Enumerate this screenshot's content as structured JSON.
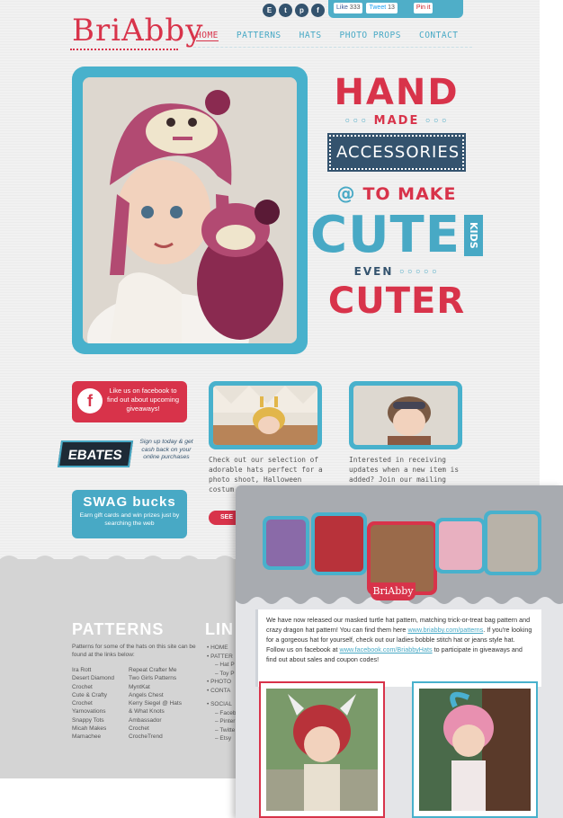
{
  "site": {
    "logo": "BriAbby",
    "social_icons": [
      "E",
      "t",
      "p",
      "f"
    ],
    "share": {
      "like": "Like",
      "like_count": "333",
      "tweet": "Tweet",
      "tweet_count": "13",
      "pin": "Pin it"
    },
    "nav": [
      "HOME",
      "PATTERNS",
      "HATS",
      "PHOTO PROPS",
      "CONTACT"
    ],
    "tagline": {
      "hand": "HAND",
      "made": "MADE",
      "accessories": "ACCESSORIES",
      "to_make": "TO MAKE",
      "cute": "CUTE",
      "kids": "KIDS",
      "even": "EVEN",
      "cuter": "CUTER"
    },
    "facebook_box": {
      "icon": "f",
      "text": "Like us on facebook to find out about upcoming giveaways!"
    },
    "ebates": {
      "badge": "EBATES",
      "text": "Sign up today & get cash back on your online purchases"
    },
    "swagbucks": {
      "logo": "SWAG bucks",
      "text": "Earn gift cards and win prizes just by searching the web"
    },
    "thumb_text_1": "Check out our selection of adorable hats perfect for a photo shoot, Halloween costum... dress-",
    "thumb_text_2": "Interested in receiving updates when a new item is added? Join our mailing list",
    "see_button": "SEE"
  },
  "footer": {
    "patterns_title": "PATTERNS",
    "patterns_desc": "Patterns for some of the hats on this site can be found at the links below:",
    "patterns_col1": [
      "Ira Rott",
      "Desert Diamond",
      "Crochet",
      "Cute & Crafty",
      "Crochet",
      "Yarnovations",
      "Snappy Tots",
      "Micah Makes",
      "Mamachee"
    ],
    "patterns_col2": [
      "Repeat Crafter Me",
      "Two Girls Patterns",
      "MyntKat",
      "Angels Chest",
      "Kerry Siegel @ Hats",
      "& What Knots",
      "Ambassador",
      "Crochet",
      "CrocheTrend"
    ],
    "links_title": "LIN",
    "links": [
      {
        "text": "HOME",
        "sub": false
      },
      {
        "text": "PATTER",
        "sub": false
      },
      {
        "text": "Hat P",
        "sub": true
      },
      {
        "text": "Toy P",
        "sub": true
      },
      {
        "text": "PHOTO",
        "sub": false
      },
      {
        "text": "CONTA",
        "sub": false
      },
      {
        "text": "",
        "sub": false
      },
      {
        "text": "SOCIAL",
        "sub": false
      },
      {
        "text": "Faceb",
        "sub": true
      },
      {
        "text": "Pinter",
        "sub": true
      },
      {
        "text": "Twitte",
        "sub": true
      },
      {
        "text": "Etsy",
        "sub": true
      }
    ]
  },
  "email": {
    "logo": "BriAbby",
    "body_1": "We have now released our masked turtle hat pattern, matching trick-or-treat bag pattern and crazy dragon hat pattern! You can find them here ",
    "link_1": "www.briabby.com/patterns",
    "body_2": ". If you're looking for a gorgeous hat for yourself, check out our ladies bobble stitch hat or jeans style hat. Follow us on facebook at ",
    "link_2": "www.facebook.com/BriabbyHats",
    "body_3": " to participate in giveaways and find out about sales and coupon codes!"
  },
  "colors": {
    "red": "#d8334a",
    "blue": "#48a9c5",
    "navy": "#34536e"
  }
}
